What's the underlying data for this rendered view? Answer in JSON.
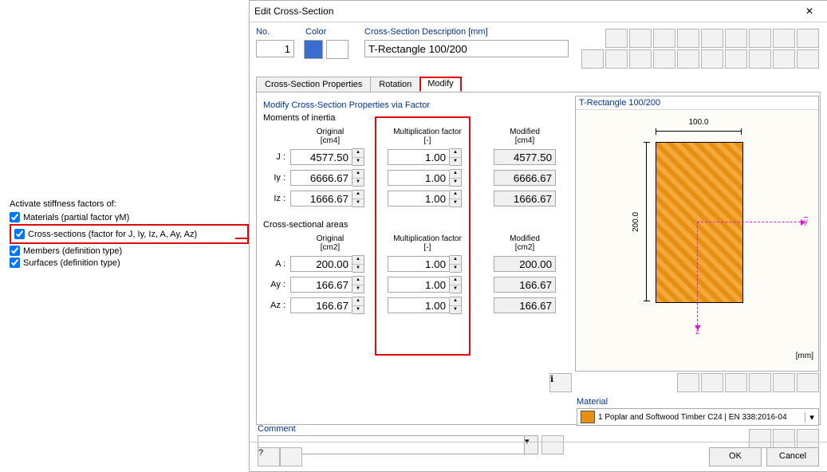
{
  "left": {
    "title": "Activate stiffness factors of:",
    "opt1": "Materials (partial factor γM)",
    "opt2": "Cross-sections (factor for J, Iy, Iz, A, Ay, Az)",
    "opt3": "Members (definition type)",
    "opt4": "Surfaces (definition type)"
  },
  "dlg": {
    "title": "Edit Cross-Section",
    "no_lbl": "No.",
    "no_val": "1",
    "color_lbl": "Color",
    "csdesc_lbl": "Cross-Section Description [mm]",
    "csdesc_val": "T-Rectangle 100/200",
    "tabs": {
      "a": "Cross-Section Properties",
      "b": "Rotation",
      "c": "Modify"
    },
    "group": "Modify Cross-Section Properties via Factor",
    "moments": "Moments of inertia",
    "areas": "Cross-sectional areas",
    "col_orig": "Original",
    "col_fact": "Multiplication factor",
    "col_mod": "Modified",
    "unit_cm4": "[cm4]",
    "unit_none": "[-]",
    "unit_cm2": "[cm2]",
    "rows_i": [
      {
        "lbl": "J :",
        "orig": "4577.50",
        "fact": "1.00",
        "mod": "4577.50"
      },
      {
        "lbl": "Iy :",
        "orig": "6666.67",
        "fact": "1.00",
        "mod": "6666.67"
      },
      {
        "lbl": "Iz :",
        "orig": "1666.67",
        "fact": "1.00",
        "mod": "1666.67"
      }
    ],
    "rows_a": [
      {
        "lbl": "A :",
        "orig": "200.00",
        "fact": "1.00",
        "mod": "200.00"
      },
      {
        "lbl": "Ay :",
        "orig": "166.67",
        "fact": "1.00",
        "mod": "166.67"
      },
      {
        "lbl": "Az :",
        "orig": "166.67",
        "fact": "1.00",
        "mod": "166.67"
      }
    ],
    "preview_title": "T-Rectangle 100/200",
    "dim_w": "100.0",
    "dim_h": "200.0",
    "unit_mm": "[mm]",
    "y": "y",
    "z": "z",
    "material_lbl": "Material",
    "material_val": "1 Poplar and Softwood Timber C24 | EN 338:2016-04",
    "comment_lbl": "Comment",
    "ok": "OK",
    "cancel": "Cancel"
  }
}
